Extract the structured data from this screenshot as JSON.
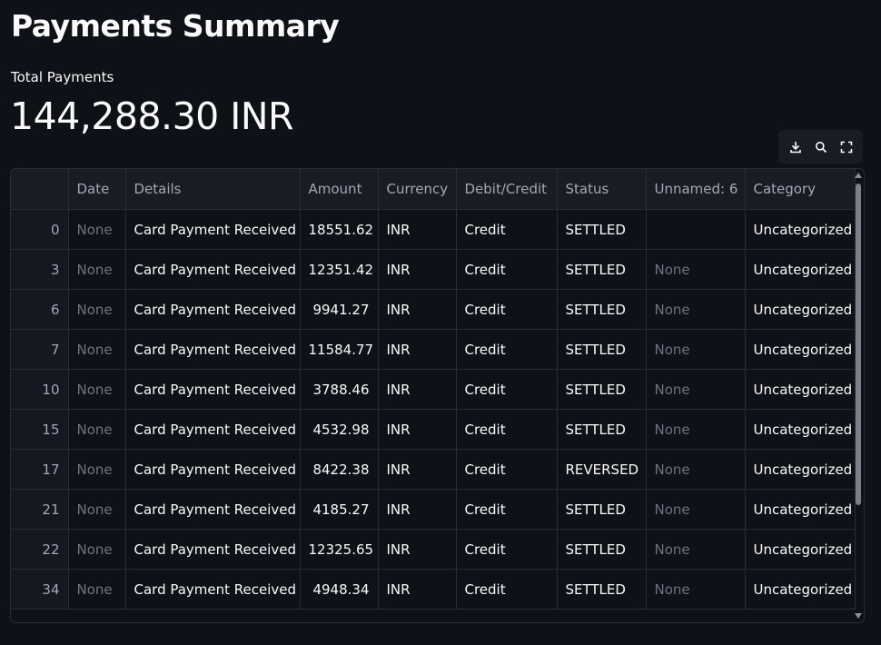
{
  "page": {
    "title": "Payments Summary",
    "metric_label": "Total Payments",
    "metric_value": "144,288.30 INR"
  },
  "toolbar": {
    "icons": [
      "download-icon",
      "search-icon",
      "fullscreen-icon"
    ]
  },
  "table": {
    "columns": [
      "",
      "Date",
      "Details",
      "Amount",
      "Currency",
      "Debit/Credit",
      "Status",
      "Unnamed: 6",
      "Category"
    ],
    "rows": [
      {
        "index": "0",
        "date": "None",
        "details": "Card Payment Received",
        "amount": "18551.62",
        "currency": "INR",
        "debit_credit": "Credit",
        "status": "SETTLED",
        "unnamed6": "",
        "category": "Uncategorized"
      },
      {
        "index": "3",
        "date": "None",
        "details": "Card Payment Received",
        "amount": "12351.42",
        "currency": "INR",
        "debit_credit": "Credit",
        "status": "SETTLED",
        "unnamed6": "None",
        "category": "Uncategorized"
      },
      {
        "index": "6",
        "date": "None",
        "details": "Card Payment Received",
        "amount": "9941.27",
        "currency": "INR",
        "debit_credit": "Credit",
        "status": "SETTLED",
        "unnamed6": "None",
        "category": "Uncategorized"
      },
      {
        "index": "7",
        "date": "None",
        "details": "Card Payment Received",
        "amount": "11584.77",
        "currency": "INR",
        "debit_credit": "Credit",
        "status": "SETTLED",
        "unnamed6": "None",
        "category": "Uncategorized"
      },
      {
        "index": "10",
        "date": "None",
        "details": "Card Payment Received",
        "amount": "3788.46",
        "currency": "INR",
        "debit_credit": "Credit",
        "status": "SETTLED",
        "unnamed6": "None",
        "category": "Uncategorized"
      },
      {
        "index": "15",
        "date": "None",
        "details": "Card Payment Received",
        "amount": "4532.98",
        "currency": "INR",
        "debit_credit": "Credit",
        "status": "SETTLED",
        "unnamed6": "None",
        "category": "Uncategorized"
      },
      {
        "index": "17",
        "date": "None",
        "details": "Card Payment Received",
        "amount": "8422.38",
        "currency": "INR",
        "debit_credit": "Credit",
        "status": "REVERSED",
        "unnamed6": "None",
        "category": "Uncategorized"
      },
      {
        "index": "21",
        "date": "None",
        "details": "Card Payment Received",
        "amount": "4185.27",
        "currency": "INR",
        "debit_credit": "Credit",
        "status": "SETTLED",
        "unnamed6": "None",
        "category": "Uncategorized"
      },
      {
        "index": "22",
        "date": "None",
        "details": "Card Payment Received",
        "amount": "12325.65",
        "currency": "INR",
        "debit_credit": "Credit",
        "status": "SETTLED",
        "unnamed6": "None",
        "category": "Uncategorized"
      },
      {
        "index": "34",
        "date": "None",
        "details": "Card Payment Received",
        "amount": "4948.34",
        "currency": "INR",
        "debit_credit": "Credit",
        "status": "SETTLED",
        "unnamed6": "None",
        "category": "Uncategorized"
      }
    ]
  },
  "colors": {
    "background": "#0e1117",
    "header_bg": "#1a1c24",
    "muted_text": "#a3a8b4",
    "none_text": "#6e7380",
    "border": "#2a2d36"
  }
}
